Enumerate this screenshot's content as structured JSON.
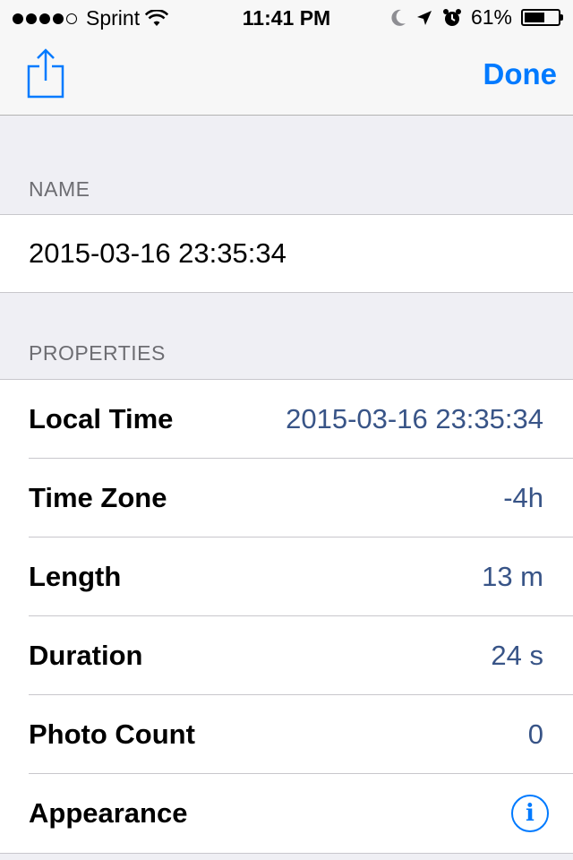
{
  "status_bar": {
    "carrier": "Sprint",
    "time": "11:41 PM",
    "battery_percent": "61%",
    "battery_level": 0.61,
    "signal_bars_filled": 4,
    "signal_bars_total": 5,
    "icons": [
      "wifi-icon",
      "moon-icon",
      "location-arrow-icon",
      "alarm-clock-icon",
      "battery-icon"
    ]
  },
  "nav": {
    "share_icon": "share-icon",
    "done_label": "Done",
    "accent_color": "#007aff"
  },
  "name_section": {
    "header": "NAME",
    "value": "2015-03-16 23:35:34"
  },
  "properties_section": {
    "header": "PROPERTIES",
    "rows": [
      {
        "label": "Local Time",
        "value": "2015-03-16 23:35:34"
      },
      {
        "label": "Time Zone",
        "value": "-4h"
      },
      {
        "label": "Length",
        "value": "13 m"
      },
      {
        "label": "Duration",
        "value": "24 s"
      },
      {
        "label": "Photo Count",
        "value": "0"
      },
      {
        "label": "Appearance",
        "icon": "info-icon"
      }
    ]
  }
}
